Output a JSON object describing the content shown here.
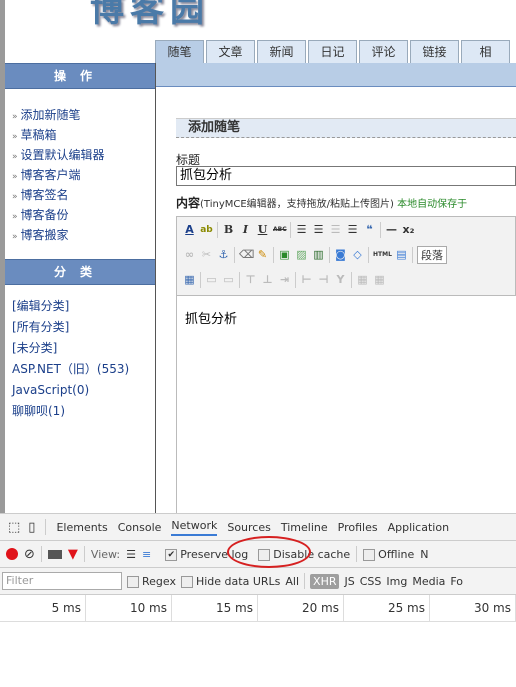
{
  "logo": "博客园",
  "tabs": [
    "随笔",
    "文章",
    "新闻",
    "日记",
    "评论",
    "链接",
    "相"
  ],
  "sidebar": {
    "ops_title": "操作",
    "ops": [
      "添加新随笔",
      "草稿箱",
      "设置默认编辑器",
      "博客客户端",
      "博客签名",
      "博客备份",
      "博客搬家"
    ],
    "cat_title": "分类",
    "cats": [
      "[编辑分类]",
      "[所有分类]",
      "[未分类]",
      "ASP.NET（旧）(553)",
      "JavaScript(0)",
      "聊聊呗(1)"
    ]
  },
  "main": {
    "section": "添加随笔",
    "title_label": "标题",
    "title_value": "抓包分析",
    "content_label": "内容",
    "content_hint": "(TinyMCE编辑器，支持拖放/粘贴上传图片)",
    "autosave": "本地自动保存于",
    "editor_text": "抓包分析",
    "format_select": "段落"
  },
  "devtools": {
    "tabs": [
      "Elements",
      "Console",
      "Network",
      "Sources",
      "Timeline",
      "Profiles",
      "Application"
    ],
    "active_tab": "Network",
    "view_label": "View:",
    "preserve_log": "Preserve log",
    "preserve_checked": true,
    "disable_cache": "Disable cache",
    "offline": "Offline",
    "more": "N",
    "filter_placeholder": "Filter",
    "regex": "Regex",
    "hide_data": "Hide data URLs",
    "types": [
      "All",
      "XHR",
      "JS",
      "CSS",
      "Img",
      "Media",
      "Fo"
    ],
    "ticks": [
      "5 ms",
      "10 ms",
      "15 ms",
      "20 ms",
      "25 ms",
      "30 ms"
    ]
  },
  "colors": {
    "header": "#6a8cbf",
    "link": "#1b3f8a",
    "annotation": "#d62020"
  }
}
